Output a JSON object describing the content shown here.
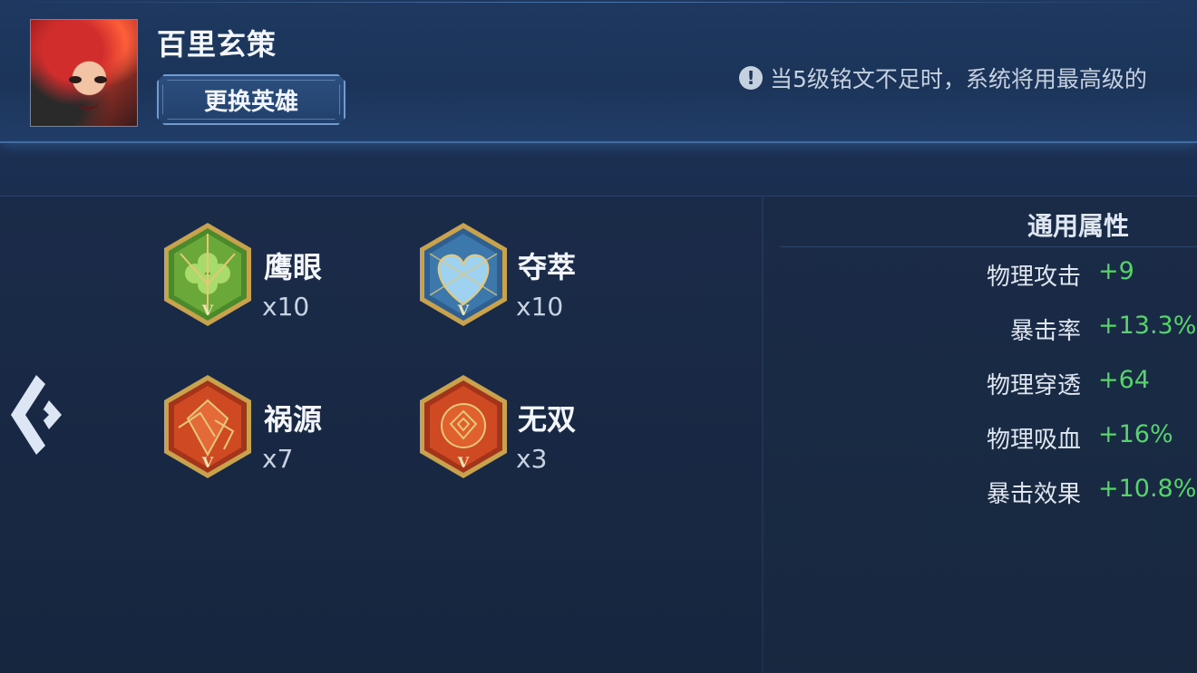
{
  "header": {
    "hero_name": "百里玄策",
    "change_hero_label": "更换英雄",
    "notice_icon": "!",
    "notice_text": "当5级铭文不足时，系统将用最高级的"
  },
  "runes": [
    {
      "name": "鹰眼",
      "count": "x10",
      "level": "V",
      "color": "green",
      "icon": "clover-rune-icon"
    },
    {
      "name": "夺萃",
      "count": "x10",
      "level": "V",
      "color": "blue",
      "icon": "heart-rune-icon"
    },
    {
      "name": "祸源",
      "count": "x7",
      "level": "V",
      "color": "red",
      "icon": "cards-rune-icon"
    },
    {
      "name": "无双",
      "count": "x3",
      "level": "V",
      "color": "red",
      "icon": "rose-rune-icon"
    }
  ],
  "stats": {
    "title": "通用属性",
    "items": [
      {
        "label": "物理攻击",
        "value": "+9"
      },
      {
        "label": "暴击率",
        "value": "+13.3%"
      },
      {
        "label": "物理穿透",
        "value": "+64"
      },
      {
        "label": "物理吸血",
        "value": "+16%"
      },
      {
        "label": "暴击效果",
        "value": "+10.8%"
      }
    ]
  },
  "colors": {
    "stat_value": "#56d36b",
    "accent_border": "#6f9bd0",
    "gold": "#d8b25c"
  }
}
